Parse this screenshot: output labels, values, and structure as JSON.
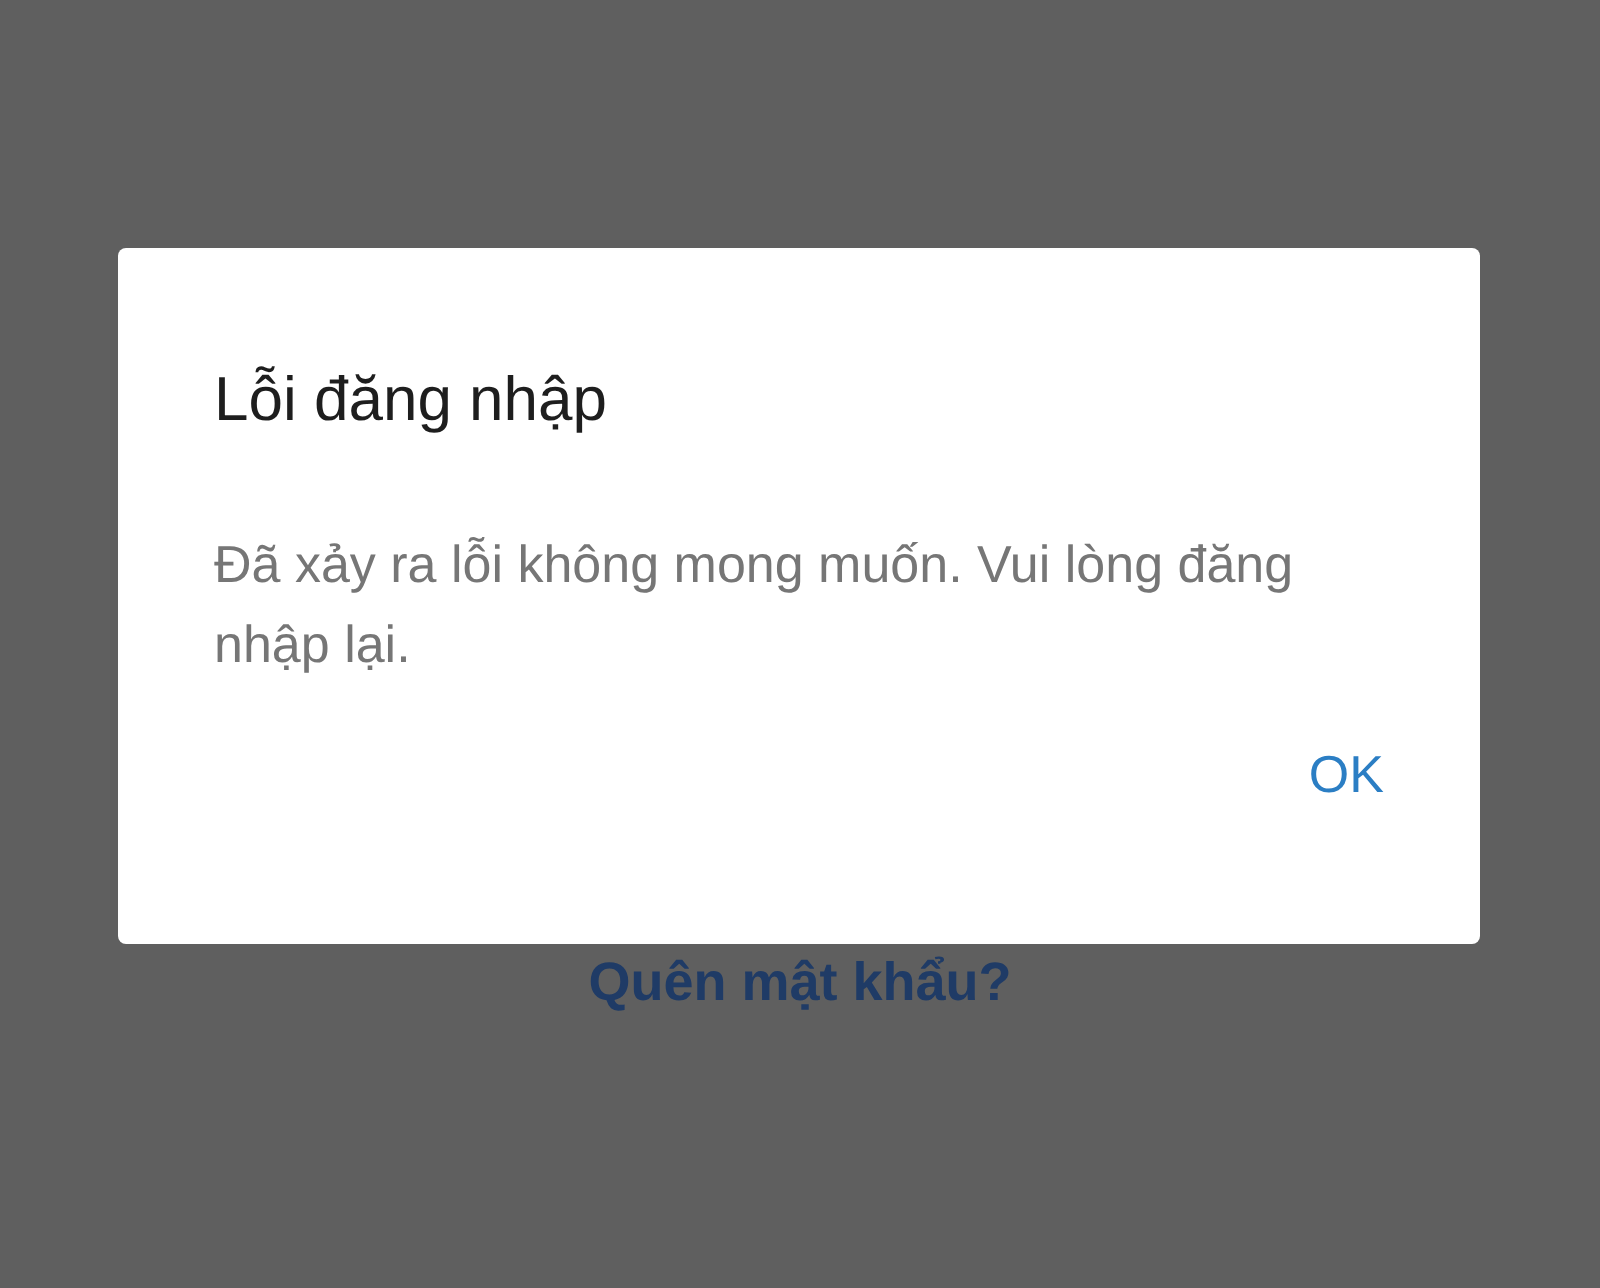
{
  "dialog": {
    "title": "Lỗi đăng nhập",
    "message": "Đã xảy ra lỗi không mong muốn. Vui lòng đăng nhập lại.",
    "buttons": [
      "OK"
    ]
  },
  "background": {
    "link": "Quên mật khẩu?"
  }
}
